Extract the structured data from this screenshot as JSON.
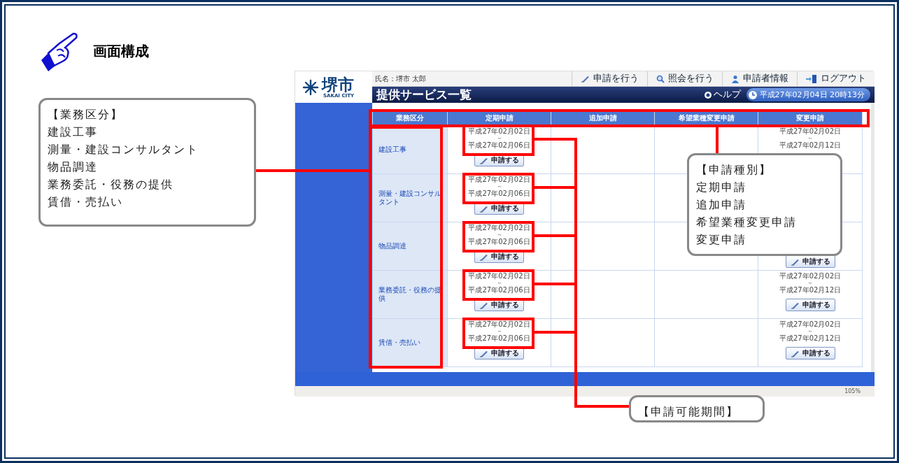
{
  "heading": "画面構成",
  "screen": {
    "logo": {
      "name": "堺市",
      "sub": "SAKAI CITY"
    },
    "user": "氏名：堺市 太郎",
    "nav": [
      {
        "kind": "pencil",
        "label": "申請を行う"
      },
      {
        "kind": "search",
        "label": "照会を行う"
      },
      {
        "kind": "person",
        "label": "申請者情報"
      },
      {
        "kind": "logout",
        "label": "ログアウト"
      }
    ],
    "title": "提供サービス一覧",
    "help": "ヘルプ",
    "datetime": "平成27年02月04日 20時13分",
    "columns": [
      "業務区分",
      "定期申請",
      "追加申請",
      "希望業種変更申請",
      "変更申請"
    ],
    "rows": [
      {
        "category": "建設工事",
        "regular": {
          "from": "平成27年02月02日",
          "sep": "～",
          "to": "平成27年02月06日",
          "button": "申請する"
        },
        "change": {
          "from": "平成27年02月02日",
          "sep": "～",
          "to": "平成27年02月12日"
        }
      },
      {
        "category": "測量・建設コンサルタント",
        "regular": {
          "from": "平成27年02月02日",
          "sep": "～",
          "to": "平成27年02月06日",
          "button": "申請する"
        }
      },
      {
        "category": "物品調達",
        "regular": {
          "from": "平成27年02月02日",
          "sep": "～",
          "to": "平成27年02月06日",
          "button": "申請する"
        },
        "change": {
          "button": "申請する"
        }
      },
      {
        "category": "業務委託・役務の提供",
        "regular": {
          "from": "平成27年02月02日",
          "sep": "～",
          "to": "平成27年02月06日",
          "button": "申請する"
        },
        "change": {
          "from": "平成27年02月02日",
          "sep": "～",
          "to": "平成27年02月12日",
          "button": "申請する"
        }
      },
      {
        "category": "賃借・売払い",
        "regular": {
          "from": "平成27年02月02日",
          "sep": "～",
          "to": "平成27年02月06日",
          "button": "申請する"
        },
        "change": {
          "from": "平成27年02月02日",
          "sep": "～",
          "to": "平成27年02月12日",
          "button": "申請する"
        }
      }
    ],
    "zoom": "105%"
  },
  "callouts": {
    "category": [
      "【業務区分】",
      "建設工事",
      "測量・建設コンサルタント",
      "物品調達",
      "業務委託・役務の提供",
      "賃借・売払い"
    ],
    "type": [
      "【申請種別】",
      "定期申請",
      "追加申請",
      "希望業種変更申請",
      "変更申請"
    ],
    "period": [
      "【申請可能期間】"
    ]
  }
}
